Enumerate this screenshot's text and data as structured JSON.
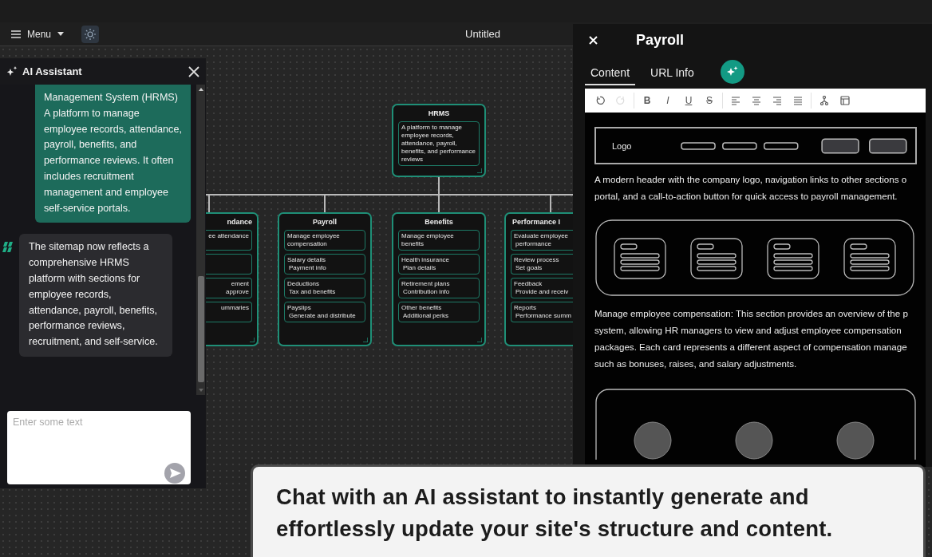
{
  "topbar": {
    "menu_label": "Menu",
    "title": "Untitled"
  },
  "sitemap": {
    "root": {
      "title": "HRMS",
      "items": [
        {
          "kind": "item",
          "lines": [
            "A platform to manage employee records, attendance, payroll, benefits, and performance reviews"
          ]
        }
      ]
    },
    "sections": [
      {
        "title": "ndance",
        "items": [
          {
            "kind": "item",
            "lines": [
              "ee attendance"
            ]
          },
          {
            "kind": "item"
          },
          {
            "kind": "item",
            "lines": [
              "ement",
              "approve"
            ]
          },
          {
            "kind": "item",
            "lines": [
              "ummaries"
            ]
          }
        ]
      },
      {
        "title": "Payroll",
        "items": [
          {
            "kind": "item",
            "lines": [
              "Manage employee compensation"
            ]
          },
          {
            "kind": "item",
            "lines": [
              "Salary details",
              "Payment info"
            ]
          },
          {
            "kind": "item",
            "lines": [
              "Deductions",
              "Tax and benefits"
            ]
          },
          {
            "kind": "item",
            "lines": [
              "Payslips",
              "Generate and distribute"
            ]
          }
        ]
      },
      {
        "title": "Benefits",
        "items": [
          {
            "kind": "item",
            "lines": [
              "Manage employee benefits"
            ]
          },
          {
            "kind": "item",
            "lines": [
              "Health insurance",
              "Plan details"
            ]
          },
          {
            "kind": "item",
            "lines": [
              "Retirement plans",
              "Contribution info"
            ]
          },
          {
            "kind": "item",
            "lines": [
              "Other benefits",
              "Additional perks"
            ]
          }
        ]
      },
      {
        "title": "Performance I",
        "items": [
          {
            "kind": "item",
            "lines": [
              "Evaluate employee",
              "performance"
            ]
          },
          {
            "kind": "item",
            "lines": [
              "Review process",
              "Set goals"
            ]
          },
          {
            "kind": "item",
            "lines": [
              "Feedback",
              "Provide and receiv"
            ]
          },
          {
            "kind": "item",
            "lines": [
              "Reports",
              "Performance summ"
            ]
          }
        ]
      }
    ]
  },
  "assistant": {
    "title": "AI Assistant",
    "messages": [
      {
        "kind": "user",
        "text": "Management System (HRMS) A platform to manage employee records, attendance, payroll, benefits, and performance reviews. It often includes recruitment management and employee self-service portals."
      },
      {
        "kind": "assistant",
        "text": "The sitemap now reflects a comprehensive HRMS platform with sections for employee records, attendance, payroll, benefits, performance reviews, recruitment, and self-service."
      }
    ],
    "input": {
      "placeholder": "Enter some text"
    }
  },
  "editor": {
    "title": "Payroll",
    "tabs": [
      {
        "label": "Content",
        "selected": true
      },
      {
        "label": "URL Info",
        "selected": false
      }
    ],
    "toolbar": [
      {
        "kind": "undo",
        "disabled": false
      },
      {
        "kind": "redo",
        "disabled": true
      },
      {
        "kind": "bold",
        "label": "B",
        "disabled": false
      },
      {
        "kind": "italic",
        "label": "I",
        "disabled": false
      },
      {
        "kind": "underline",
        "label": "U",
        "disabled": false
      },
      {
        "kind": "strike",
        "label": "S",
        "disabled": false
      },
      {
        "kind": "align-left",
        "disabled": false
      },
      {
        "kind": "align-center",
        "disabled": false
      },
      {
        "kind": "align-right",
        "disabled": false
      },
      {
        "kind": "justify",
        "disabled": false
      },
      {
        "kind": "tree",
        "disabled": false
      },
      {
        "kind": "layout",
        "disabled": false
      }
    ],
    "blocks": [
      {
        "kind": "header",
        "logo": "Logo",
        "description": [
          "A modern header with the company logo, navigation links to other sections o",
          "portal, and a call-to-action button for quick access to payroll management."
        ]
      },
      {
        "kind": "cards",
        "description": [
          "Manage employee compensation: This section provides an overview of the p",
          "system, allowing HR managers to view and adjust employee compensation",
          "packages. Each card represents a different aspect of compensation manage",
          "such as bonuses, raises, and salary adjustments."
        ]
      },
      {
        "kind": "circles"
      }
    ]
  },
  "caption": {
    "lines": [
      "Chat with an AI assistant to instantly generate and",
      "effortlessly update your site's structure and content."
    ]
  }
}
